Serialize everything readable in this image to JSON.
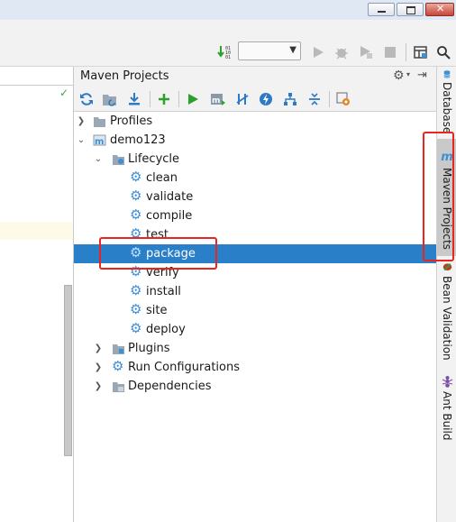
{
  "window": {
    "minimize_icon": "minimize-icon",
    "restore_icon": "restore-icon",
    "close_icon": "close-icon"
  },
  "toolbar": {
    "run_config_value": ""
  },
  "panel": {
    "title": "Maven Projects",
    "tree": {
      "profiles": "Profiles",
      "project": "demo123",
      "lifecycle": "Lifecycle",
      "goals": [
        "clean",
        "validate",
        "compile",
        "test",
        "package",
        "verify",
        "install",
        "site",
        "deploy"
      ],
      "selected_goal": "package",
      "plugins": "Plugins",
      "run_configurations": "Run Configurations",
      "dependencies": "Dependencies"
    }
  },
  "right_tabs": {
    "database": "Database",
    "maven": "Maven Projects",
    "bean": "Bean Validation",
    "ant": "Ant Build"
  },
  "colors": {
    "selection": "#2a7fc9",
    "highlight": "#e8261f",
    "accent_green": "#2ca02c",
    "maven_blue": "#3d8fd6"
  }
}
